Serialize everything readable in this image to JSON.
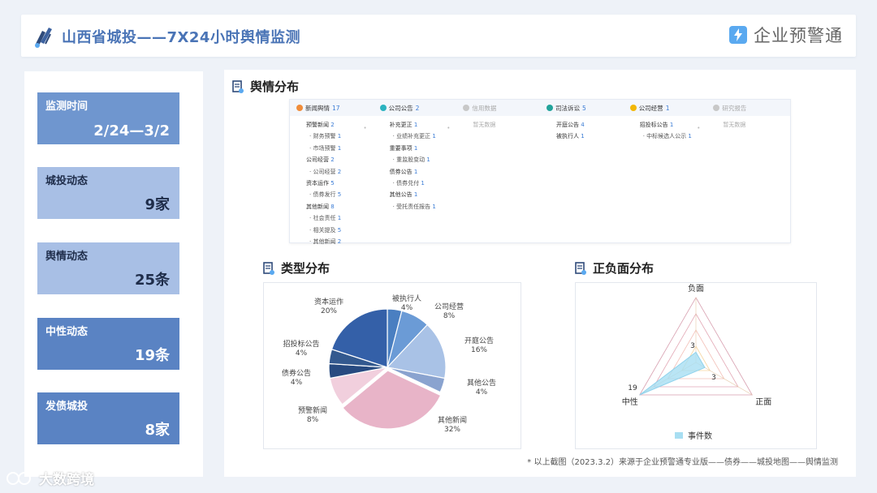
{
  "header": {
    "title": "山西省城投——7X24小时舆情监测",
    "brand": "企业预警通"
  },
  "stats": [
    {
      "label": "监测时间",
      "value": "2/24—3/2"
    },
    {
      "label": "城投动态",
      "value": "9家"
    },
    {
      "label": "舆情动态",
      "value": "25条"
    },
    {
      "label": "中性动态",
      "value": "19条"
    },
    {
      "label": "发债城投",
      "value": "8家"
    }
  ],
  "sections": {
    "distribution": "舆情分布",
    "type": "类型分布",
    "sentiment": "正负面分布"
  },
  "distribution": {
    "columns": [
      {
        "label": "新闻舆情",
        "count": "17",
        "color": "#f08c3a"
      },
      {
        "label": "公司公告",
        "count": "2",
        "color": "#2bb3c0"
      },
      {
        "label": "信用数据",
        "count": "",
        "color": "#c8c8c8"
      },
      {
        "label": "司法诉讼",
        "count": "5",
        "color": "#22a39a"
      },
      {
        "label": "公司经营",
        "count": "1",
        "color": "#f2b705"
      },
      {
        "label": "研究报告",
        "count": "",
        "color": "#c8c8c8"
      }
    ],
    "col1": [
      {
        "t": "预警新闻",
        "n": "2",
        "sub": false
      },
      {
        "t": "· 财务预警",
        "n": "1",
        "sub": true
      },
      {
        "t": "· 市场预警",
        "n": "1",
        "sub": true
      },
      {
        "t": "公司经营",
        "n": "2",
        "sub": false
      },
      {
        "t": "· 公司经营",
        "n": "2",
        "sub": true
      },
      {
        "t": "资本运作",
        "n": "5",
        "sub": false
      },
      {
        "t": "· 债券发行",
        "n": "5",
        "sub": true
      },
      {
        "t": "其他新闻",
        "n": "8",
        "sub": false
      },
      {
        "t": "· 社会责任",
        "n": "1",
        "sub": true
      },
      {
        "t": "· 相关提及",
        "n": "5",
        "sub": true
      },
      {
        "t": "· 其他新闻",
        "n": "2",
        "sub": true
      }
    ],
    "col2": [
      {
        "t": "补充更正",
        "n": "1",
        "sub": false
      },
      {
        "t": "· 业绩补充更正",
        "n": "1",
        "sub": true
      },
      {
        "t": "重要事项",
        "n": "1",
        "sub": false
      },
      {
        "t": "· 重监股变动",
        "n": "1",
        "sub": true
      },
      {
        "t": "债券公告",
        "n": "1",
        "sub": false
      },
      {
        "t": "· 债券兑付",
        "n": "1",
        "sub": true
      },
      {
        "t": "其他公告",
        "n": "1",
        "sub": false
      },
      {
        "t": "· 受托责任报告",
        "n": "1",
        "sub": true
      }
    ],
    "col3_empty": "暂无数据",
    "col4": [
      {
        "t": "开庭公告",
        "n": "4",
        "sub": false
      },
      {
        "t": "被执行人",
        "n": "1",
        "sub": false
      }
    ],
    "col5": [
      {
        "t": "招投标公告",
        "n": "1",
        "sub": false
      },
      {
        "t": "· 中标候选人公示",
        "n": "1",
        "sub": true
      }
    ],
    "col6_empty": "暂无数据"
  },
  "chart_data": [
    {
      "type": "pie",
      "title": "类型分布",
      "slices": [
        {
          "label": "被执行人",
          "pct": "4%",
          "value": 4,
          "color": "#4a7fc1"
        },
        {
          "label": "公司经营",
          "pct": "8%",
          "value": 8,
          "color": "#6b9bd6"
        },
        {
          "label": "开庭公告",
          "pct": "16%",
          "value": 16,
          "color": "#a9c2e6"
        },
        {
          "label": "其他公告",
          "pct": "4%",
          "value": 4,
          "color": "#8aa3cf"
        },
        {
          "label": "其他新闻",
          "pct": "32%",
          "value": 32,
          "color": "#e8b4c8"
        },
        {
          "label": "预警新闻",
          "pct": "8%",
          "value": 8,
          "color": "#f1cfdd"
        },
        {
          "label": "债券公告",
          "pct": "4%",
          "value": 4,
          "color": "#274a80"
        },
        {
          "label": "招投标公告",
          "pct": "4%",
          "value": 4,
          "color": "#33598f"
        },
        {
          "label": "资本运作",
          "pct": "20%",
          "value": 20,
          "color": "#3460a8"
        }
      ]
    },
    {
      "type": "radar",
      "title": "正负面分布",
      "axes": [
        "负面",
        "正面",
        "中性"
      ],
      "series": [
        {
          "name": "事件数",
          "values": [
            3,
            3,
            19
          ]
        }
      ],
      "max": 19,
      "ring_labels": [
        "3",
        "3",
        "19"
      ]
    }
  ],
  "footnote": "* 以上截图（2023.3.2）来源于企业预警通专业版——债券——城投地图——舆情监测",
  "watermark": "大数跨境",
  "colors": {
    "accent": "#4a74b6",
    "stat_light": "#a7bde3",
    "stat_dark": "#5a83c3"
  }
}
